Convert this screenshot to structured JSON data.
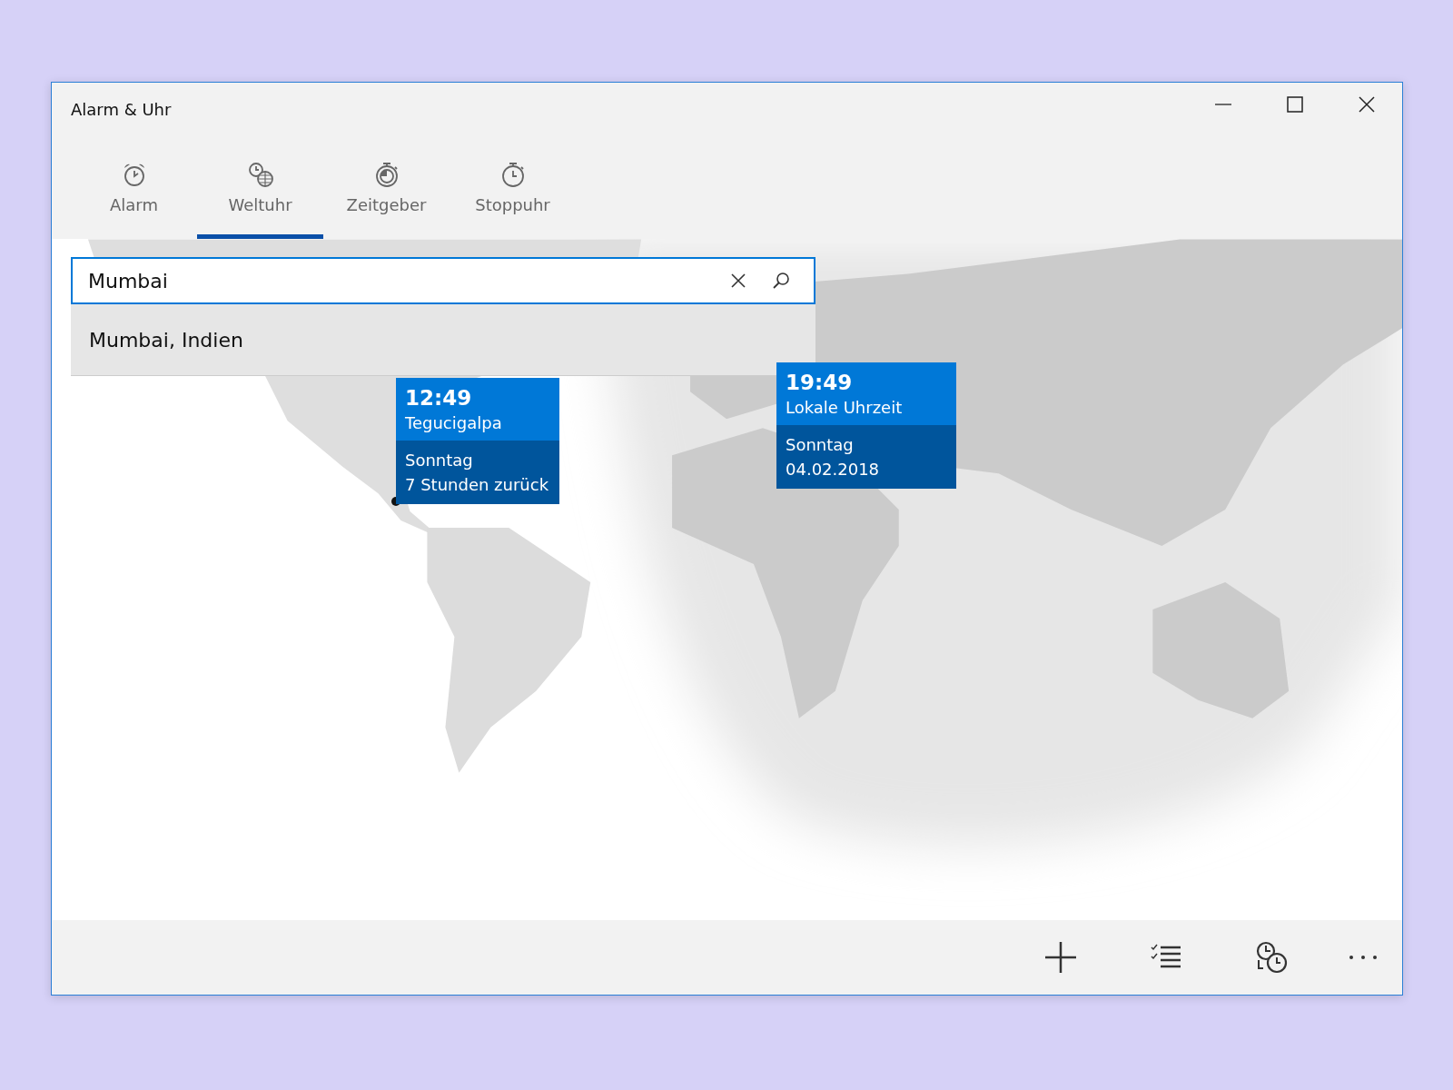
{
  "window": {
    "title": "Alarm & Uhr"
  },
  "tabs": [
    {
      "label": "Alarm",
      "kind": "alarm",
      "selected": false
    },
    {
      "label": "Weltuhr",
      "kind": "worldclock",
      "selected": true
    },
    {
      "label": "Zeitgeber",
      "kind": "timer",
      "selected": false
    },
    {
      "label": "Stoppuhr",
      "kind": "stopwatch",
      "selected": false
    }
  ],
  "search": {
    "value": "Mumbai"
  },
  "suggestions": [
    {
      "label": "Mumbai, Indien"
    }
  ],
  "clocks": [
    {
      "time": "12:49",
      "city": "Tegucigalpa",
      "day": "Sonntag",
      "detail": "7 Stunden zurück",
      "marker": true
    },
    {
      "time": "19:49",
      "city": "Lokale Uhrzeit",
      "day": "Sonntag",
      "detail": "04.02.2018",
      "marker": false
    }
  ]
}
